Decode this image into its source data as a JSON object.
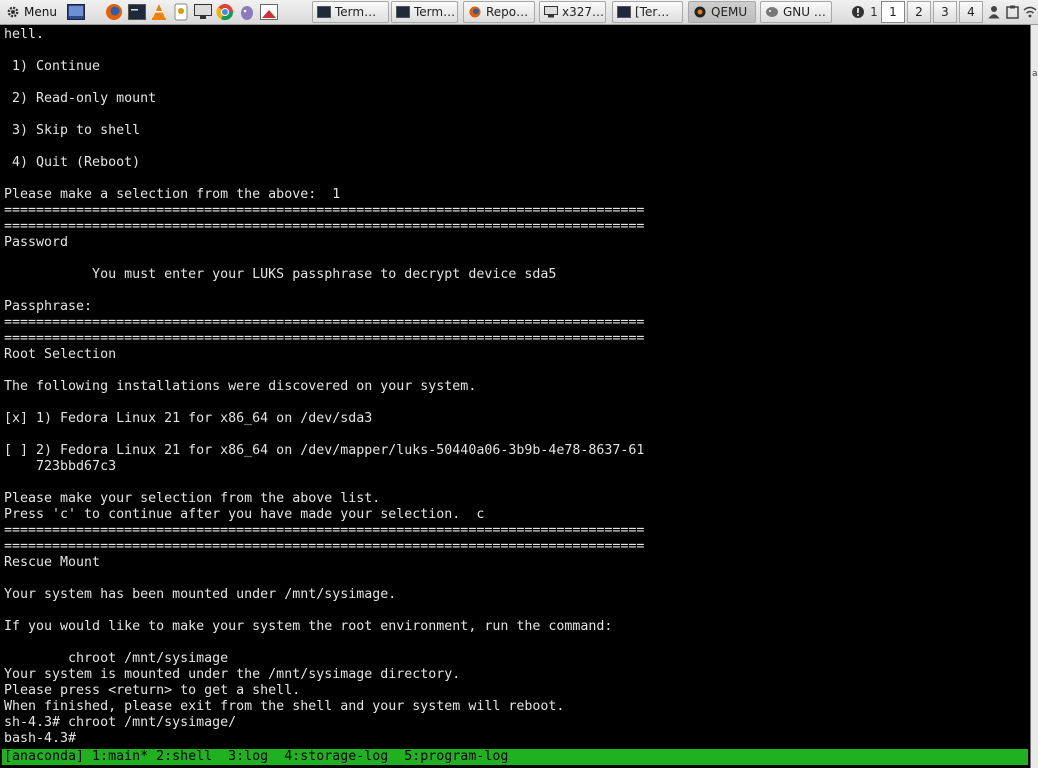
{
  "panel": {
    "menu_label": "Menu",
    "tasks": [
      "Term…",
      "Term…",
      "Repo…",
      "x327…",
      "[Ter…",
      "QEMU",
      "GNU …"
    ],
    "workspaces": [
      "1",
      "2",
      "3",
      "4"
    ],
    "notify_count": "1"
  },
  "terminal": {
    "lines": [
      "hell.",
      "",
      " 1) Continue",
      "",
      " 2) Read-only mount",
      "",
      " 3) Skip to shell",
      "",
      " 4) Quit (Reboot)",
      "",
      "Please make a selection from the above:  1",
      "================================================================================",
      "================================================================================",
      "Password",
      "",
      "           You must enter your LUKS passphrase to decrypt device sda5",
      "",
      "Passphrase:",
      "================================================================================",
      "================================================================================",
      "Root Selection",
      "",
      "The following installations were discovered on your system.",
      "",
      "[x] 1) Fedora Linux 21 for x86_64 on /dev/sda3",
      "",
      "[ ] 2) Fedora Linux 21 for x86_64 on /dev/mapper/luks-50440a06-3b9b-4e78-8637-61",
      "    723bbd67c3",
      "",
      "Please make your selection from the above list.",
      "Press 'c' to continue after you have made your selection.  c",
      "================================================================================",
      "================================================================================",
      "Rescue Mount",
      "",
      "Your system has been mounted under /mnt/sysimage.",
      "",
      "If you would like to make your system the root environment, run the command:",
      "",
      "        chroot /mnt/sysimage",
      "Your system is mounted under the /mnt/sysimage directory.",
      "Please press <return> to get a shell.",
      "When finished, please exit from the shell and your system will reboot.",
      "sh-4.3# chroot /mnt/sysimage/",
      "bash-4.3#"
    ],
    "status_bar": "[anaconda] 1:main* 2:shell  3:log  4:storage-log  5:program-log"
  }
}
